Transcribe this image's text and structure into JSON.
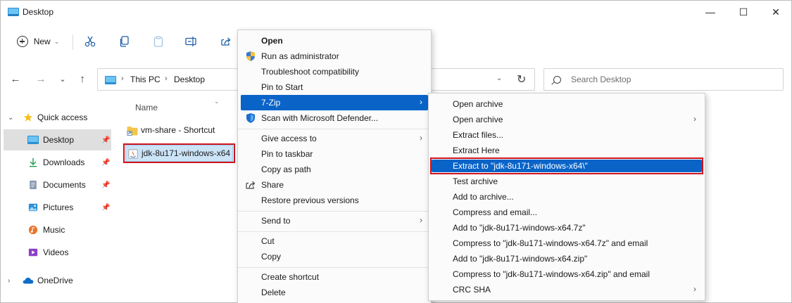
{
  "window": {
    "title": "Desktop",
    "minimize": "—",
    "maximize": "☐",
    "close": "✕"
  },
  "toolbar": {
    "new_label": "New",
    "new_chevron": "⌄"
  },
  "address": {
    "root": "This PC",
    "current": "Desktop",
    "separator": "›",
    "dropdown": "⌄",
    "refresh": "↻"
  },
  "search": {
    "placeholder": "Search Desktop"
  },
  "nav_buttons": {
    "back": "←",
    "forward": "→",
    "recent": "⌄",
    "up": "↑"
  },
  "nav_pane": {
    "quick_access": "Quick access",
    "items": [
      {
        "label": "Desktop",
        "pinned": true
      },
      {
        "label": "Downloads",
        "pinned": true
      },
      {
        "label": "Documents",
        "pinned": true
      },
      {
        "label": "Pictures",
        "pinned": true
      },
      {
        "label": "Music",
        "pinned": false
      },
      {
        "label": "Videos",
        "pinned": false
      }
    ],
    "onedrive": "OneDrive",
    "pin_glyph": "📌"
  },
  "file_list": {
    "column_name": "Name",
    "files": [
      {
        "name": "vm-share - Shortcut",
        "icon": "folder-shortcut-icon"
      },
      {
        "name": "jdk-8u171-windows-x64",
        "icon": "installer-icon"
      }
    ]
  },
  "context_menu": {
    "items": [
      {
        "label": "Open"
      },
      {
        "label": "Run as administrator"
      },
      {
        "label": "Troubleshoot compatibility"
      },
      {
        "label": "Pin to Start"
      },
      {
        "label": "7-Zip"
      },
      {
        "label": "Scan with Microsoft Defender..."
      },
      {
        "label": "Give access to"
      },
      {
        "label": "Pin to taskbar"
      },
      {
        "label": "Copy as path"
      },
      {
        "label": "Share"
      },
      {
        "label": "Restore previous versions"
      },
      {
        "label": "Send to"
      },
      {
        "label": "Cut"
      },
      {
        "label": "Copy"
      },
      {
        "label": "Create shortcut"
      },
      {
        "label": "Delete"
      }
    ],
    "submenu_arrow": "›"
  },
  "submenu": {
    "items": [
      {
        "label": "Open archive"
      },
      {
        "label": "Open archive"
      },
      {
        "label": "Extract files..."
      },
      {
        "label": "Extract Here"
      },
      {
        "label": "Extract to \"jdk-8u171-windows-x64\\\""
      },
      {
        "label": "Test archive"
      },
      {
        "label": "Add to archive..."
      },
      {
        "label": "Compress and email..."
      },
      {
        "label": "Add to \"jdk-8u171-windows-x64.7z\""
      },
      {
        "label": "Compress to \"jdk-8u171-windows-x64.7z\" and email"
      },
      {
        "label": "Add to \"jdk-8u171-windows-x64.zip\""
      },
      {
        "label": "Compress to \"jdk-8u171-windows-x64.zip\" and email"
      },
      {
        "label": "CRC SHA"
      }
    ]
  },
  "colors": {
    "accent": "#0a64c8",
    "highlight_box": "#d0141b",
    "selection": "#cce4f7"
  }
}
